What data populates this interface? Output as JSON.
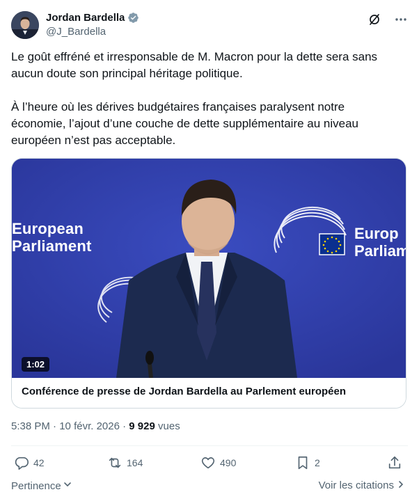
{
  "author": {
    "display_name": "Jordan Bardella",
    "handle": "@J_Bardella",
    "verified_color": "#829aab"
  },
  "tweet": {
    "paragraph_1": "Le goût effréné et irresponsable de M. Macron pour la dette sera sans aucun doute son principal héritage politique.",
    "paragraph_2": "À l’heure où les dérives budgétaires françaises paralysent notre économie, l’ajout d’une couche de dette supplémentaire au niveau européen n’est pas acceptable."
  },
  "media": {
    "duration": "1:02",
    "caption": "Conférence de presse de Jordan Bardella au Parlement européen",
    "backdrop_text_left_1": "European",
    "backdrop_text_left_2": "Parliament",
    "backdrop_text_right_1": "Europ",
    "backdrop_text_right_2": "Parliam",
    "backdrop_color": "#2f3ea8"
  },
  "meta": {
    "time": "5:38 PM",
    "separator": "·",
    "date": "10 févr. 2026",
    "views_count": "9 929",
    "views_label": "vues"
  },
  "actions": {
    "replies": "42",
    "reposts": "164",
    "likes": "490",
    "bookmarks": "2"
  },
  "footer": {
    "sort_label": "Pertinence",
    "quotes_label": "Voir les citations"
  },
  "icons": {
    "header": [
      "grok-icon",
      "more-icon"
    ],
    "actions": [
      "reply-icon",
      "repost-icon",
      "like-icon",
      "bookmark-icon",
      "share-icon"
    ]
  },
  "colors": {
    "text": "#0f1419",
    "muted": "#536471",
    "border": "#cfd9de"
  }
}
